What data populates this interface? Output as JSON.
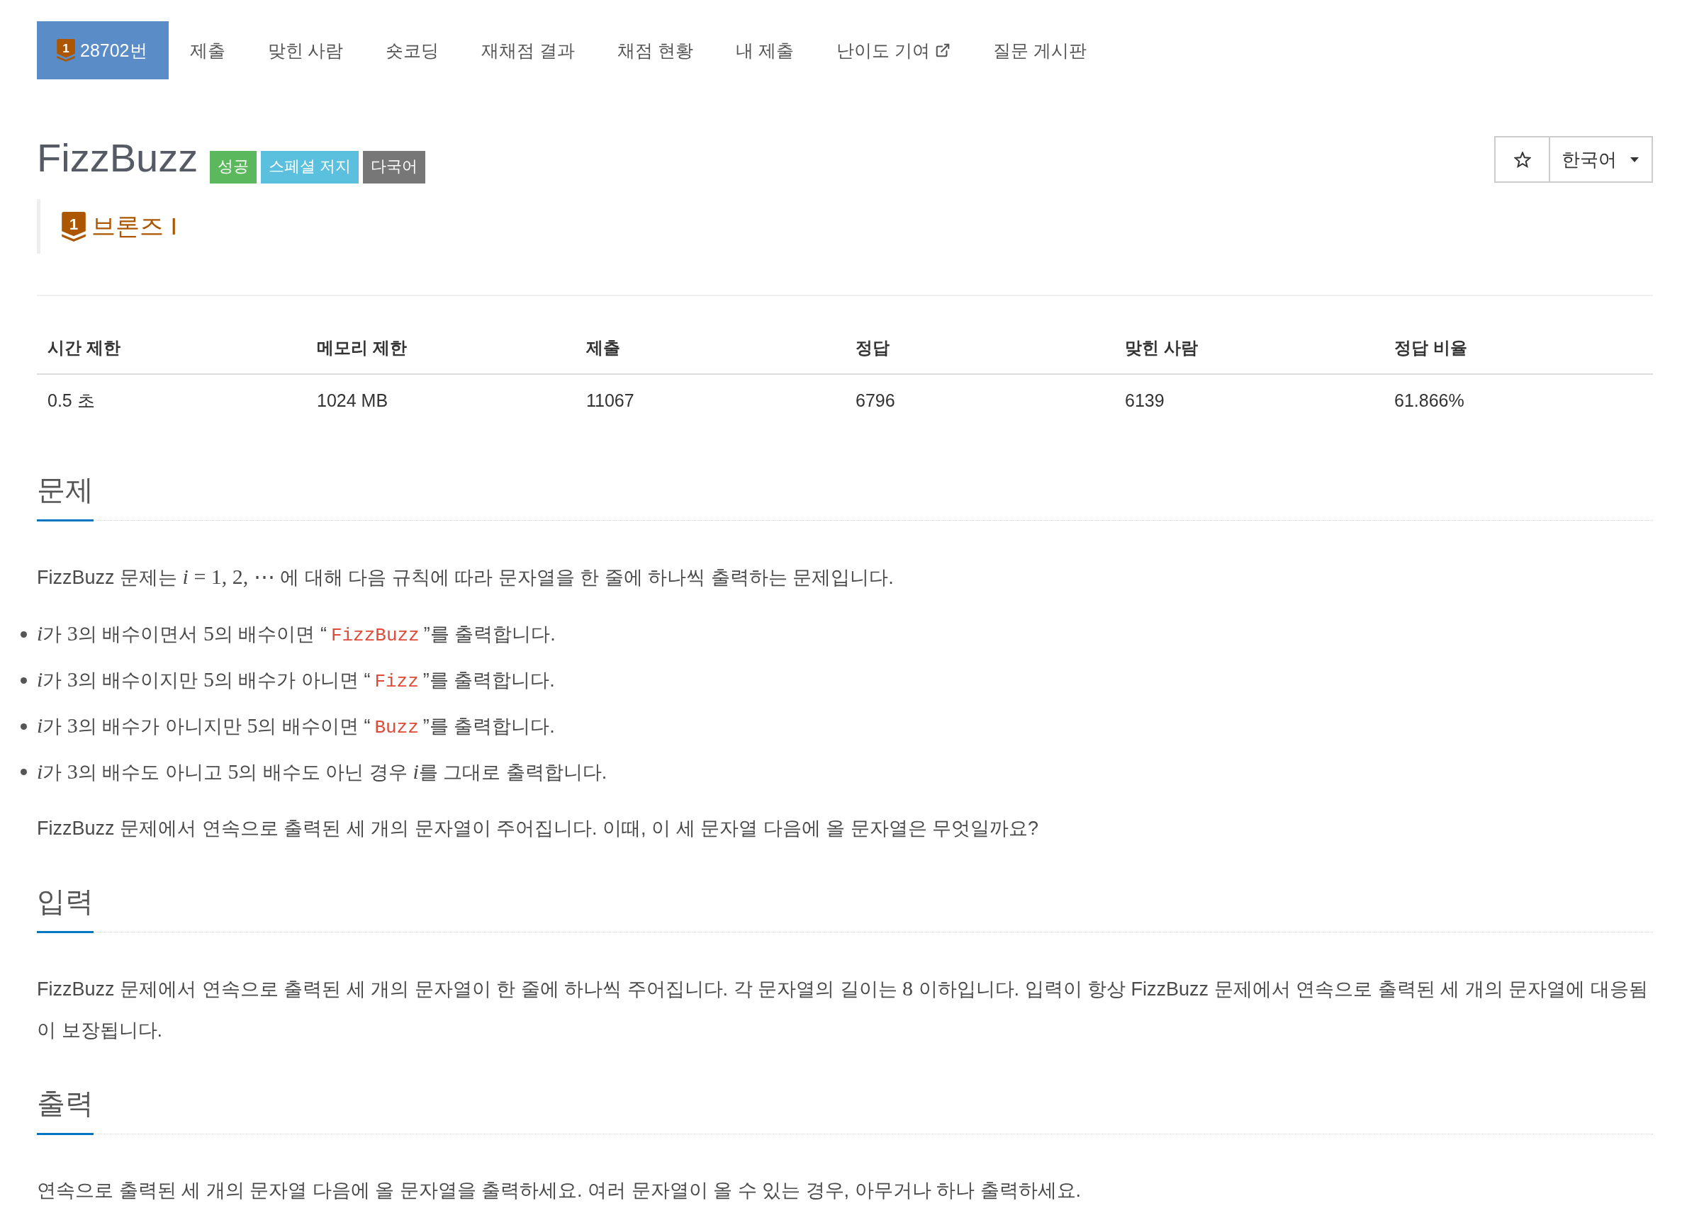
{
  "nav": {
    "tabs": [
      {
        "label": "28702번",
        "kind": "problem",
        "badge": "1",
        "selected": true
      },
      {
        "label": "제출",
        "kind": "plain",
        "selected": false
      },
      {
        "label": "맞힌 사람",
        "kind": "plain",
        "selected": false
      },
      {
        "label": "숏코딩",
        "kind": "plain",
        "selected": false
      },
      {
        "label": "재채점 결과",
        "kind": "plain",
        "selected": false
      },
      {
        "label": "채점 현황",
        "kind": "plain",
        "selected": false
      },
      {
        "label": "내 제출",
        "kind": "plain",
        "selected": false
      },
      {
        "label": "난이도 기여",
        "kind": "external",
        "selected": false
      },
      {
        "label": "질문 게시판",
        "kind": "plain",
        "selected": false
      }
    ]
  },
  "problem": {
    "title": "FizzBuzz",
    "labels": [
      {
        "text": "성공",
        "color": "#5cb85c"
      },
      {
        "text": "스페셜 저지",
        "color": "#5bc0de"
      },
      {
        "text": "다국어",
        "color": "#777777"
      }
    ],
    "tier": {
      "badge": "1",
      "name": "브론즈 I"
    },
    "favorite": {
      "on": false
    },
    "language": {
      "value": "한국어"
    }
  },
  "info_table": {
    "columns": [
      "시간 제한",
      "메모리 제한",
      "제출",
      "정답",
      "맞힌 사람",
      "정답 비율"
    ],
    "rows": [
      [
        "0.5 초",
        "1024 MB",
        "11067",
        "6796",
        "6139",
        "61.866%"
      ]
    ]
  },
  "sections": [
    {
      "heading": "문제",
      "blocks": [
        {
          "kind": "paragraph",
          "segments": [
            {
              "kind": "text",
              "text": "FizzBuzz 문제는 "
            },
            {
              "kind": "var",
              "text": "i"
            },
            {
              "kind": "math",
              "text": " = 1, 2, ⋯ "
            },
            {
              "kind": "text",
              "text": "에 대해 다음 규칙에 따라 문자열을 한 줄에 하나씩 출력하는 문제입니다."
            }
          ]
        },
        {
          "kind": "list",
          "items": [
            {
              "segments": [
                {
                  "kind": "var",
                  "text": "i"
                },
                {
                  "kind": "text",
                  "text": "가 "
                },
                {
                  "kind": "math",
                  "text": "3"
                },
                {
                  "kind": "text",
                  "text": "의 배수이면서 "
                },
                {
                  "kind": "math",
                  "text": "5"
                },
                {
                  "kind": "text",
                  "text": "의 배수이면 “"
                },
                {
                  "kind": "code",
                  "text": "FizzBuzz"
                },
                {
                  "kind": "text",
                  "text": "”를 출력합니다."
                }
              ]
            },
            {
              "segments": [
                {
                  "kind": "var",
                  "text": "i"
                },
                {
                  "kind": "text",
                  "text": "가 "
                },
                {
                  "kind": "math",
                  "text": "3"
                },
                {
                  "kind": "text",
                  "text": "의 배수이지만 "
                },
                {
                  "kind": "math",
                  "text": "5"
                },
                {
                  "kind": "text",
                  "text": "의 배수가 아니면 “"
                },
                {
                  "kind": "code",
                  "text": "Fizz"
                },
                {
                  "kind": "text",
                  "text": "”를 출력합니다."
                }
              ]
            },
            {
              "segments": [
                {
                  "kind": "var",
                  "text": "i"
                },
                {
                  "kind": "text",
                  "text": "가 "
                },
                {
                  "kind": "math",
                  "text": "3"
                },
                {
                  "kind": "text",
                  "text": "의 배수가 아니지만 "
                },
                {
                  "kind": "math",
                  "text": "5"
                },
                {
                  "kind": "text",
                  "text": "의 배수이면 “"
                },
                {
                  "kind": "code",
                  "text": "Buzz"
                },
                {
                  "kind": "text",
                  "text": "”를 출력합니다."
                }
              ]
            },
            {
              "segments": [
                {
                  "kind": "var",
                  "text": "i"
                },
                {
                  "kind": "text",
                  "text": "가 "
                },
                {
                  "kind": "math",
                  "text": "3"
                },
                {
                  "kind": "text",
                  "text": "의 배수도 아니고 "
                },
                {
                  "kind": "math",
                  "text": "5"
                },
                {
                  "kind": "text",
                  "text": "의 배수도 아닌 경우 "
                },
                {
                  "kind": "var",
                  "text": "i"
                },
                {
                  "kind": "text",
                  "text": "를 그대로 출력합니다."
                }
              ]
            }
          ]
        },
        {
          "kind": "paragraph",
          "segments": [
            {
              "kind": "text",
              "text": "FizzBuzz 문제에서 연속으로 출력된 세 개의 문자열이 주어집니다. 이때, 이 세 문자열 다음에 올 문자열은 무엇일까요?"
            }
          ]
        }
      ]
    },
    {
      "heading": "입력",
      "blocks": [
        {
          "kind": "paragraph",
          "segments": [
            {
              "kind": "text",
              "text": "FizzBuzz 문제에서 연속으로 출력된 세 개의 문자열이 한 줄에 하나씩 주어집니다. 각 문자열의 길이는 "
            },
            {
              "kind": "math",
              "text": "8"
            },
            {
              "kind": "text",
              "text": " 이하입니다. 입력이 항상 FizzBuzz 문제에서 연속으로 출력된 세 개의 문자열에 대응됨이 보장됩니다."
            }
          ]
        }
      ]
    },
    {
      "heading": "출력",
      "blocks": [
        {
          "kind": "paragraph",
          "segments": [
            {
              "kind": "text",
              "text": "연속으로 출력된 세 개의 문자열 다음에 올 문자열을 출력하세요. 여러 문자열이 올 수 있는 경우, 아무거나 하나 출력하세요."
            }
          ]
        }
      ]
    }
  ]
}
